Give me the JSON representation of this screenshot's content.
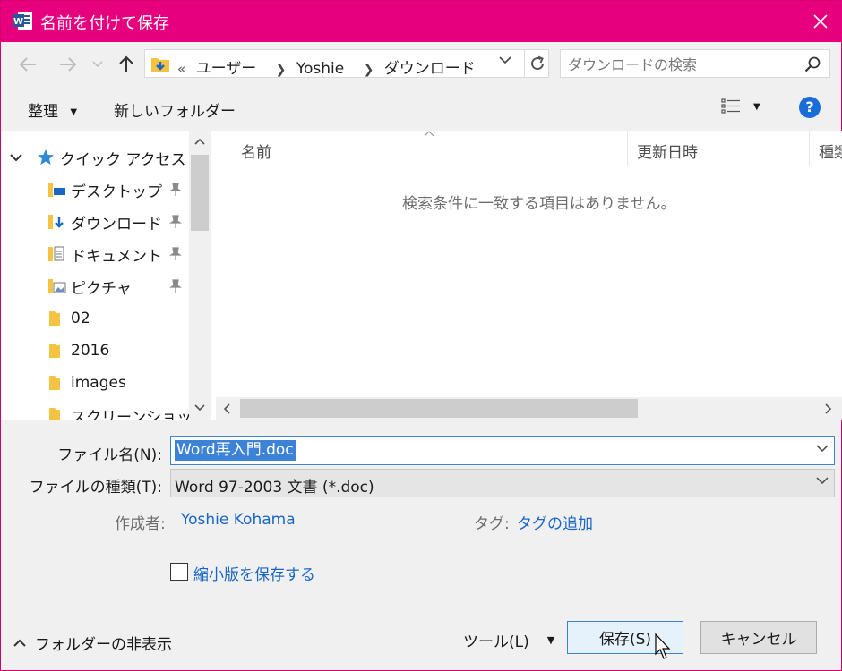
{
  "window": {
    "title": "名前を付けて保存",
    "accent": "#e6007e"
  },
  "address": {
    "overflow": "«",
    "crumbs": [
      "ユーザー",
      "Yoshie",
      "ダウンロード"
    ],
    "search_placeholder": "ダウンロードの検索"
  },
  "toolbar": {
    "organize": "整理",
    "new_folder": "新しいフォルダー"
  },
  "nav": {
    "quick_access": "クイック アクセス",
    "items": [
      {
        "label": "デスクトップ",
        "icon": "desktop-folder-icon",
        "pinned": true
      },
      {
        "label": "ダウンロード",
        "icon": "downloads-folder-icon",
        "pinned": true
      },
      {
        "label": "ドキュメント",
        "icon": "documents-folder-icon",
        "pinned": true
      },
      {
        "label": "ピクチャ",
        "icon": "pictures-folder-icon",
        "pinned": true
      },
      {
        "label": "02",
        "icon": "folder-icon",
        "pinned": false
      },
      {
        "label": "2016",
        "icon": "folder-icon",
        "pinned": false
      },
      {
        "label": "images",
        "icon": "folder-icon",
        "pinned": false
      },
      {
        "label": "スクリーンショット",
        "icon": "folder-icon",
        "pinned": false
      }
    ]
  },
  "files": {
    "columns": [
      "名前",
      "更新日時",
      "種類"
    ],
    "empty_message": "検索条件に一致する項目はありません。"
  },
  "form": {
    "filename_label": "ファイル名(N):",
    "filename_value": "Word再入門.doc",
    "filetype_label": "ファイルの種類(T):",
    "filetype_value": "Word 97-2003 文書 (*.doc)",
    "author_label": "作成者:",
    "author_value": "Yoshie Kohama",
    "tags_label": "タグ:",
    "tags_value": "タグの追加",
    "thumbnail_label": "縮小版を保存する"
  },
  "footer": {
    "hide_folders": "フォルダーの非表示",
    "tools": "ツール(L)",
    "save": "保存(S)",
    "cancel": "キャンセル"
  }
}
